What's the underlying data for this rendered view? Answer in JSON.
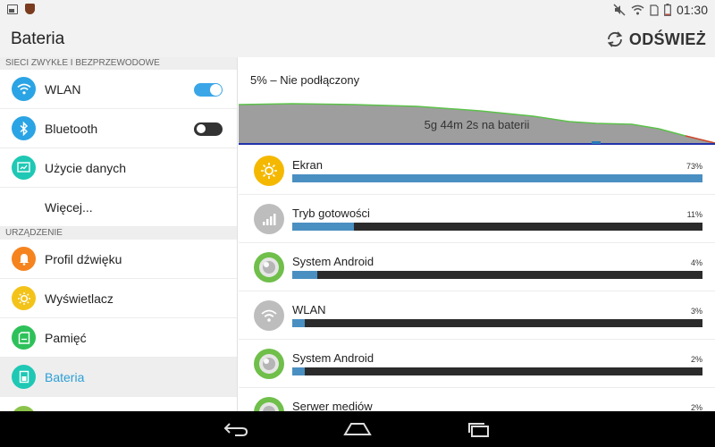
{
  "status_bar": {
    "time": "01:30",
    "icons": [
      "image-notification-icon",
      "shield-app-icon",
      "mute-icon",
      "wifi-icon",
      "sim-icon",
      "battery-icon"
    ]
  },
  "action_bar": {
    "title": "Bateria",
    "refresh_label": "ODŚWIEŻ"
  },
  "sidebar": {
    "section_wireless": "SIECI ZWYKŁE I BEZPRZEWODOWE",
    "section_device": "URZĄDZENIE",
    "items": [
      {
        "label": "WLAN",
        "icon": "wifi-icon",
        "color": "#2aa4e4",
        "toggle": "on"
      },
      {
        "label": "Bluetooth",
        "icon": "bluetooth-icon",
        "color": "#2aa4e4",
        "toggle": "off"
      },
      {
        "label": "Użycie danych",
        "icon": "data-usage-icon",
        "color": "#1ec8b4"
      },
      {
        "label": "Więcej...",
        "icon": "",
        "color": ""
      },
      {
        "label": "Profil dźwięku",
        "icon": "bell-icon",
        "color": "#f5841f"
      },
      {
        "label": "Wyświetlacz",
        "icon": "display-icon",
        "color": "#f3c31a"
      },
      {
        "label": "Pamięć",
        "icon": "storage-icon",
        "color": "#2ec15a"
      },
      {
        "label": "Bateria",
        "icon": "battery-icon",
        "color": "#1ec8b4"
      }
    ]
  },
  "content": {
    "battery_status": "5% – Nie podłączony",
    "graph_label": "5g 44m 2s na baterii",
    "usage": [
      {
        "name": "Ekran",
        "percent_label": "73%",
        "fill": 1.0,
        "icon": "display-brightness-icon",
        "color": "#f5b800"
      },
      {
        "name": "Tryb gotowości",
        "percent_label": "11%",
        "fill": 0.15,
        "icon": "signal-standby-icon",
        "color": "#bdbdbd"
      },
      {
        "name": "System Android",
        "percent_label": "4%",
        "fill": 0.06,
        "icon": "android-system-icon",
        "color": "#6fbf4a"
      },
      {
        "name": "WLAN",
        "percent_label": "3%",
        "fill": 0.03,
        "icon": "wifi-usage-icon",
        "color": "#bdbdbd"
      },
      {
        "name": "System Android",
        "percent_label": "2%",
        "fill": 0.03,
        "icon": "android-system-icon",
        "color": "#6fbf4a"
      },
      {
        "name": "Serwer mediów",
        "percent_label": "2%",
        "fill": 0.03,
        "icon": "media-server-icon",
        "color": "#6fbf4a"
      }
    ]
  },
  "navigation": {
    "buttons": [
      "back-icon",
      "home-icon",
      "recents-icon"
    ]
  }
}
